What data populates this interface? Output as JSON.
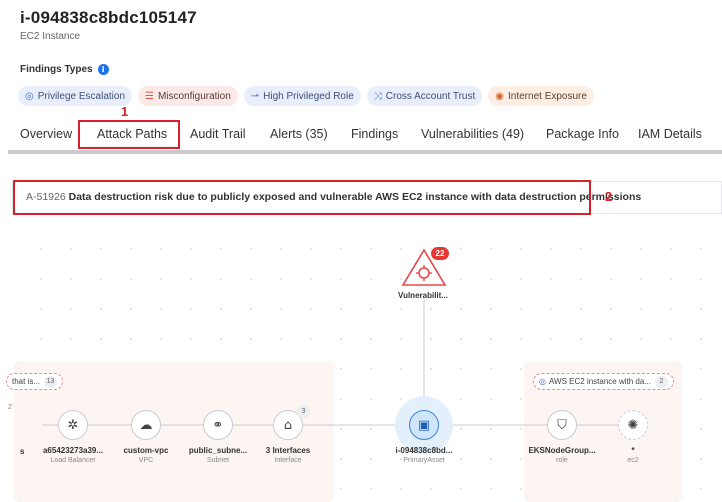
{
  "header": {
    "instance_id": "i-094838c8bdc105147",
    "instance_type": "EC2 Instance"
  },
  "findings": {
    "title": "Findings Types",
    "chips": [
      {
        "label": "Privilege Escalation",
        "icon": "privilege-escalation-icon",
        "tone": "blue"
      },
      {
        "label": "Misconfiguration",
        "icon": "misconfiguration-icon",
        "tone": "red"
      },
      {
        "label": "High Privileged Role",
        "icon": "high-privileged-role-icon",
        "tone": "blue"
      },
      {
        "label": "Cross Account Trust",
        "icon": "cross-account-trust-icon",
        "tone": "blue"
      },
      {
        "label": "Internet Exposure",
        "icon": "internet-exposure-icon",
        "tone": "orange"
      }
    ]
  },
  "tabs": [
    {
      "label": "Overview"
    },
    {
      "label": "Attack Paths"
    },
    {
      "label": "Audit Trail"
    },
    {
      "label": "Alerts (35)"
    },
    {
      "label": "Findings"
    },
    {
      "label": "Vulnerabilities (49)"
    },
    {
      "label": "Package Info"
    },
    {
      "label": "IAM Details"
    }
  ],
  "annotations": {
    "marker1": "1",
    "marker2": "2"
  },
  "attack_path": {
    "id": "A-51926",
    "description": "Data destruction risk due to publicly exposed and vulnerable AWS EC2 instance with data destruction permissions"
  },
  "graph": {
    "vulnerability": {
      "label": "Vulnerabilit...",
      "count": "22"
    },
    "left_pill": {
      "text": "that is...",
      "count": "13"
    },
    "right_pill": {
      "text": "AWS EC2 instance with da...",
      "count": "2"
    },
    "left_edge_label": "s",
    "left_edge_count": "2",
    "nodes": [
      {
        "label": "a65423273a39...",
        "sub": "Load Balancer"
      },
      {
        "label": "custom-vpc",
        "sub": "VPC"
      },
      {
        "label": "public_subne...",
        "sub": "Subnet"
      },
      {
        "label": "3 Interfaces",
        "sub": "Interface",
        "count": "3"
      },
      {
        "label": "i-094838c8bd...",
        "sub": "PrimaryAsset"
      },
      {
        "label": "EKSNodeGroup...",
        "sub": "role"
      },
      {
        "label": "*",
        "sub": "ec2"
      }
    ]
  },
  "colors": {
    "accent_red": "#d8222a",
    "primary_blue": "#3b7fd9"
  }
}
